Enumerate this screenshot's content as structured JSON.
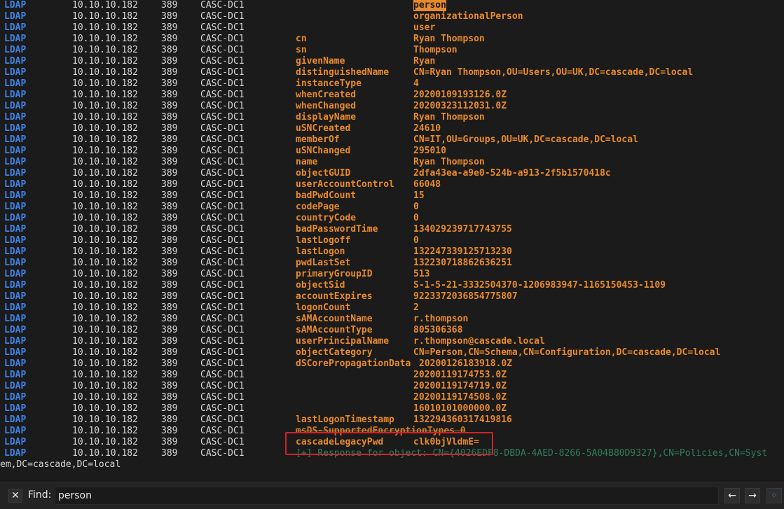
{
  "terminal": {
    "rows": [
      {
        "proto": "LDAP",
        "ip": "10.10.10.182",
        "port": "389",
        "host": "CASC-DC1",
        "attr": "",
        "val": "person",
        "highlight": true
      },
      {
        "proto": "LDAP",
        "ip": "10.10.10.182",
        "port": "389",
        "host": "CASC-DC1",
        "attr": "",
        "val": "organizationalPerson"
      },
      {
        "proto": "LDAP",
        "ip": "10.10.10.182",
        "port": "389",
        "host": "CASC-DC1",
        "attr": "",
        "val": "user"
      },
      {
        "proto": "LDAP",
        "ip": "10.10.10.182",
        "port": "389",
        "host": "CASC-DC1",
        "attr": "cn",
        "val": "Ryan Thompson"
      },
      {
        "proto": "LDAP",
        "ip": "10.10.10.182",
        "port": "389",
        "host": "CASC-DC1",
        "attr": "sn",
        "val": "Thompson"
      },
      {
        "proto": "LDAP",
        "ip": "10.10.10.182",
        "port": "389",
        "host": "CASC-DC1",
        "attr": "givenName",
        "val": "Ryan"
      },
      {
        "proto": "LDAP",
        "ip": "10.10.10.182",
        "port": "389",
        "host": "CASC-DC1",
        "attr": "distinguishedName",
        "val": "CN=Ryan Thompson,OU=Users,OU=UK,DC=cascade,DC=local"
      },
      {
        "proto": "LDAP",
        "ip": "10.10.10.182",
        "port": "389",
        "host": "CASC-DC1",
        "attr": "instanceType",
        "val": "4"
      },
      {
        "proto": "LDAP",
        "ip": "10.10.10.182",
        "port": "389",
        "host": "CASC-DC1",
        "attr": "whenCreated",
        "val": "20200109193126.0Z"
      },
      {
        "proto": "LDAP",
        "ip": "10.10.10.182",
        "port": "389",
        "host": "CASC-DC1",
        "attr": "whenChanged",
        "val": "20200323112031.0Z"
      },
      {
        "proto": "LDAP",
        "ip": "10.10.10.182",
        "port": "389",
        "host": "CASC-DC1",
        "attr": "displayName",
        "val": "Ryan Thompson"
      },
      {
        "proto": "LDAP",
        "ip": "10.10.10.182",
        "port": "389",
        "host": "CASC-DC1",
        "attr": "uSNCreated",
        "val": "24610"
      },
      {
        "proto": "LDAP",
        "ip": "10.10.10.182",
        "port": "389",
        "host": "CASC-DC1",
        "attr": "memberOf",
        "val": "CN=IT,OU=Groups,OU=UK,DC=cascade,DC=local"
      },
      {
        "proto": "LDAP",
        "ip": "10.10.10.182",
        "port": "389",
        "host": "CASC-DC1",
        "attr": "uSNChanged",
        "val": "295010"
      },
      {
        "proto": "LDAP",
        "ip": "10.10.10.182",
        "port": "389",
        "host": "CASC-DC1",
        "attr": "name",
        "val": "Ryan Thompson"
      },
      {
        "proto": "LDAP",
        "ip": "10.10.10.182",
        "port": "389",
        "host": "CASC-DC1",
        "attr": "objectGUID",
        "val": "2dfa43ea-a9e0-524b-a913-2f5b1570418c"
      },
      {
        "proto": "LDAP",
        "ip": "10.10.10.182",
        "port": "389",
        "host": "CASC-DC1",
        "attr": "userAccountControl",
        "val": "66048"
      },
      {
        "proto": "LDAP",
        "ip": "10.10.10.182",
        "port": "389",
        "host": "CASC-DC1",
        "attr": "badPwdCount",
        "val": "15"
      },
      {
        "proto": "LDAP",
        "ip": "10.10.10.182",
        "port": "389",
        "host": "CASC-DC1",
        "attr": "codePage",
        "val": "0"
      },
      {
        "proto": "LDAP",
        "ip": "10.10.10.182",
        "port": "389",
        "host": "CASC-DC1",
        "attr": "countryCode",
        "val": "0"
      },
      {
        "proto": "LDAP",
        "ip": "10.10.10.182",
        "port": "389",
        "host": "CASC-DC1",
        "attr": "badPasswordTime",
        "val": "134029239717743755"
      },
      {
        "proto": "LDAP",
        "ip": "10.10.10.182",
        "port": "389",
        "host": "CASC-DC1",
        "attr": "lastLogoff",
        "val": "0"
      },
      {
        "proto": "LDAP",
        "ip": "10.10.10.182",
        "port": "389",
        "host": "CASC-DC1",
        "attr": "lastLogon",
        "val": "132247339125713230"
      },
      {
        "proto": "LDAP",
        "ip": "10.10.10.182",
        "port": "389",
        "host": "CASC-DC1",
        "attr": "pwdLastSet",
        "val": "132230718862636251"
      },
      {
        "proto": "LDAP",
        "ip": "10.10.10.182",
        "port": "389",
        "host": "CASC-DC1",
        "attr": "primaryGroupID",
        "val": "513"
      },
      {
        "proto": "LDAP",
        "ip": "10.10.10.182",
        "port": "389",
        "host": "CASC-DC1",
        "attr": "objectSid",
        "val": "S-1-5-21-3332504370-1206983947-1165150453-1109"
      },
      {
        "proto": "LDAP",
        "ip": "10.10.10.182",
        "port": "389",
        "host": "CASC-DC1",
        "attr": "accountExpires",
        "val": "9223372036854775807"
      },
      {
        "proto": "LDAP",
        "ip": "10.10.10.182",
        "port": "389",
        "host": "CASC-DC1",
        "attr": "logonCount",
        "val": "2"
      },
      {
        "proto": "LDAP",
        "ip": "10.10.10.182",
        "port": "389",
        "host": "CASC-DC1",
        "attr": "sAMAccountName",
        "val": "r.thompson"
      },
      {
        "proto": "LDAP",
        "ip": "10.10.10.182",
        "port": "389",
        "host": "CASC-DC1",
        "attr": "sAMAccountType",
        "val": "805306368"
      },
      {
        "proto": "LDAP",
        "ip": "10.10.10.182",
        "port": "389",
        "host": "CASC-DC1",
        "attr": "userPrincipalName",
        "val": "r.thompson@cascade.local"
      },
      {
        "proto": "LDAP",
        "ip": "10.10.10.182",
        "port": "389",
        "host": "CASC-DC1",
        "attr": "objectCategory",
        "val": "CN=Person,CN=Schema,CN=Configuration,DC=cascade,DC=local"
      },
      {
        "proto": "LDAP",
        "ip": "10.10.10.182",
        "port": "389",
        "host": "CASC-DC1",
        "attr": "dSCorePropagationData",
        "val": "20200126183918.0Z",
        "inline": true
      },
      {
        "proto": "LDAP",
        "ip": "10.10.10.182",
        "port": "389",
        "host": "CASC-DC1",
        "attr": "",
        "val": "20200119174753.0Z"
      },
      {
        "proto": "LDAP",
        "ip": "10.10.10.182",
        "port": "389",
        "host": "CASC-DC1",
        "attr": "",
        "val": "20200119174719.0Z"
      },
      {
        "proto": "LDAP",
        "ip": "10.10.10.182",
        "port": "389",
        "host": "CASC-DC1",
        "attr": "",
        "val": "20200119174508.0Z"
      },
      {
        "proto": "LDAP",
        "ip": "10.10.10.182",
        "port": "389",
        "host": "CASC-DC1",
        "attr": "",
        "val": "16010101000000.0Z"
      },
      {
        "proto": "LDAP",
        "ip": "10.10.10.182",
        "port": "389",
        "host": "CASC-DC1",
        "attr": "lastLogonTimestamp",
        "val": "132294360317419816"
      },
      {
        "proto": "LDAP",
        "ip": "10.10.10.182",
        "port": "389",
        "host": "CASC-DC1",
        "attr": "msDS-SupportedEncryptionTypes 0",
        "val": "",
        "strike": true
      },
      {
        "proto": "LDAP",
        "ip": "10.10.10.182",
        "port": "389",
        "host": "CASC-DC1",
        "attr": "cascadeLegacyPwd",
        "val": "clk0bjVldmE="
      },
      {
        "proto": "LDAP",
        "ip": "10.10.10.182",
        "port": "389",
        "host": "CASC-DC1",
        "attr": "[+] Response for object: CN={4026EDF8-DBDA-4AED-8266-5A04B80D9327},CN=Policies,CN=Syst",
        "val": "",
        "dim": true
      }
    ],
    "wrap_text": "em,DC=cascade,DC=local"
  },
  "findbar": {
    "close_glyph": "✕",
    "label": "Find:",
    "query": "person",
    "prev_glyph": "🡠",
    "next_glyph": "🡢",
    "options_glyph": "⁘"
  }
}
